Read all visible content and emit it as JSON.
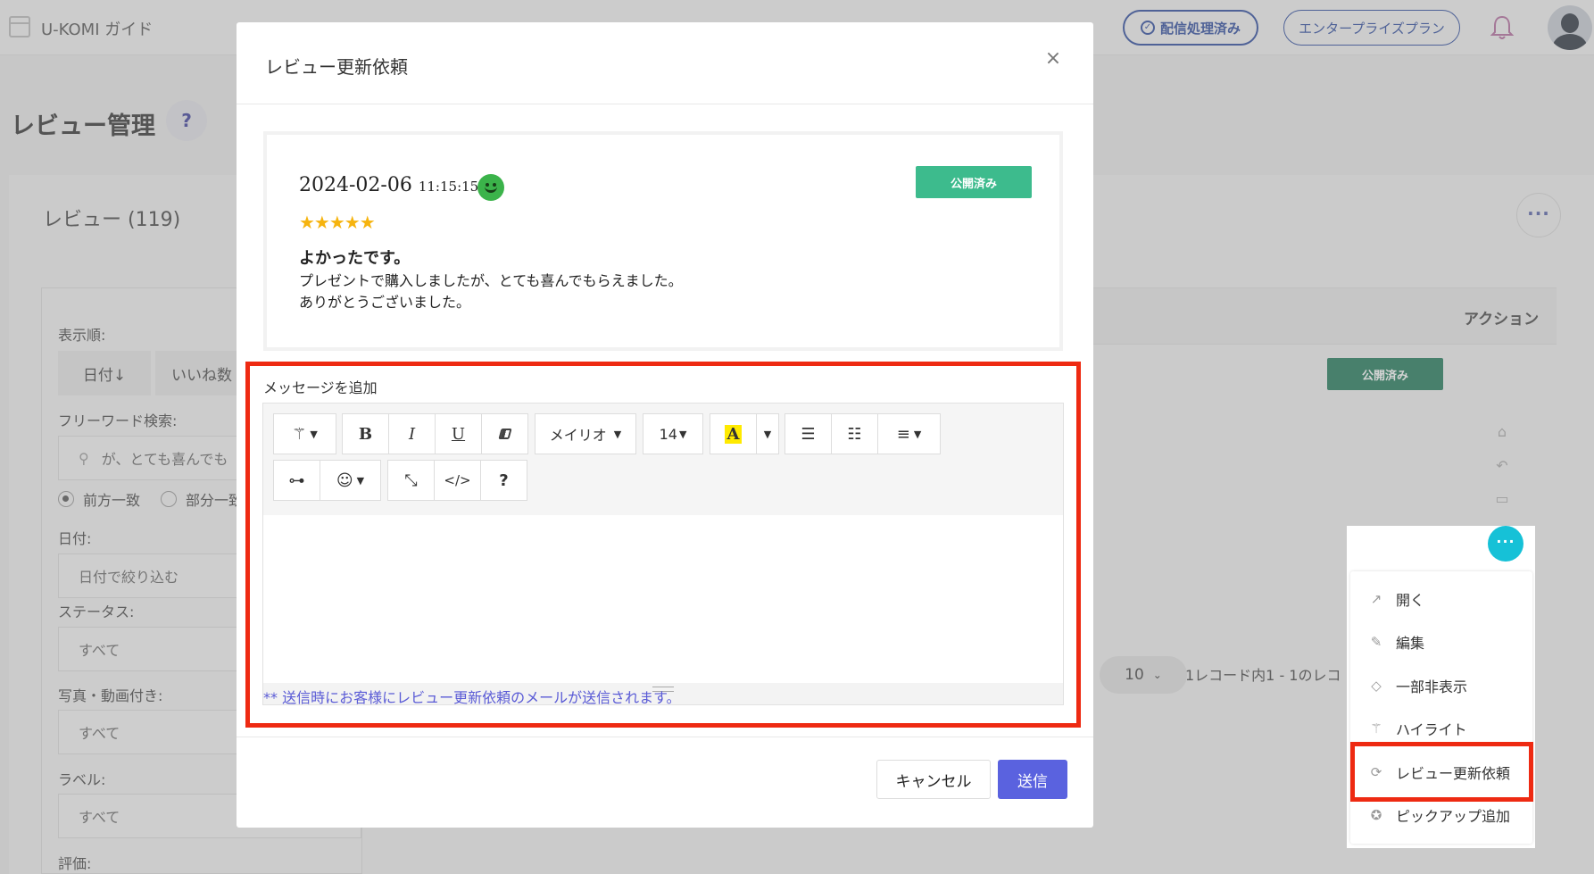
{
  "app": {
    "title": "U-KOMI ガイド"
  },
  "header": {
    "delivered_badge": "配信処理済み",
    "plan_badge": "エンタープライズプラン"
  },
  "page": {
    "title": "レビュー管理",
    "help": "?"
  },
  "reviews": {
    "header": "レビュー (119)",
    "more": "···"
  },
  "filters": {
    "sort_label": "表示順:",
    "sort_date": "日付↓",
    "sort_likes": "いいね数",
    "search_label": "フリーワード検索:",
    "search_value": "が、とても喜んでも",
    "match_prefix": "前方一致",
    "match_partial": "部分一致",
    "date_label": "日付:",
    "date_placeholder": "日付で絞り込む",
    "status_label": "ステータス:",
    "status_value": "すべて",
    "media_label": "写真・動画付き:",
    "media_value": "すべて",
    "label_label": "ラベル:",
    "label_value": "すべて",
    "rating_label": "評価:"
  },
  "table": {
    "action_header": "アクション",
    "row_status": "公開済み"
  },
  "pager": {
    "page_size": "10",
    "info": "1レコード内1 - 1のレコ"
  },
  "modal": {
    "title": "レビュー更新依頼",
    "close": "×",
    "review": {
      "date": "2024-02-06",
      "time": "11:15:15",
      "status": "公開済み",
      "rating": 5,
      "stars": "★★★★★",
      "title": "よかったです。",
      "body_lines": [
        "プレゼントで購入しましたが、とても喜んでもらえました。",
        "ありがとうございました。"
      ]
    },
    "message_label": "メッセージを追加",
    "toolbar": {
      "font_name": "メイリオ",
      "font_size": "14",
      "bold": "B",
      "italic": "I",
      "underline": "U",
      "color_a": "A",
      "code": "</>",
      "help": "?"
    },
    "notice": "** 送信時にお客様にレビュー更新依頼のメールが送信されます。",
    "cancel": "キャンセル",
    "send": "送信"
  },
  "context_menu": {
    "dots": "···",
    "items": [
      "開く",
      "編集",
      "一部非表示",
      "ハイライト",
      "レビュー更新依頼",
      "ピックアップ追加"
    ]
  },
  "colors": {
    "accent": "#5a62df",
    "published": "#3dbb8d",
    "highlight": "#ee2a12",
    "menu_dots": "#16c1d7"
  }
}
